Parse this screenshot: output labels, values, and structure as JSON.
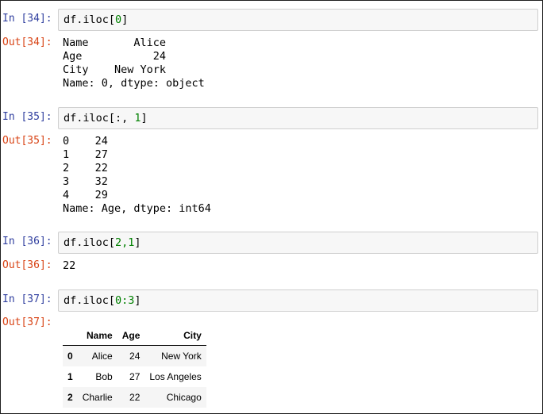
{
  "cells": [
    {
      "in_prompt": "In [34]:",
      "code": {
        "pre": "df.iloc[",
        "num": "0",
        "post": "]"
      },
      "out_prompt": "Out[34]:",
      "output": "Name       Alice\nAge           24\nCity    New York\nName: 0, dtype: object"
    },
    {
      "in_prompt": "In [35]:",
      "code": {
        "pre": "df.iloc[:, ",
        "num": "1",
        "post": "]"
      },
      "out_prompt": "Out[35]:",
      "output": "0    24\n1    27\n2    22\n3    32\n4    29\nName: Age, dtype: int64"
    },
    {
      "in_prompt": "In [36]:",
      "code": {
        "pre": "df.iloc[",
        "num": "2,1",
        "post": "]"
      },
      "out_prompt": "Out[36]:",
      "output": "22"
    },
    {
      "in_prompt": "In [37]:",
      "code": {
        "pre": "df.iloc[",
        "num": "0:3",
        "post": "]"
      },
      "out_prompt": "Out[37]:",
      "table": {
        "columns": [
          "",
          "Name",
          "Age",
          "City"
        ],
        "rows": [
          [
            "0",
            "Alice",
            "24",
            "New York"
          ],
          [
            "1",
            "Bob",
            "27",
            "Los Angeles"
          ],
          [
            "2",
            "Charlie",
            "22",
            "Chicago"
          ]
        ]
      }
    }
  ]
}
